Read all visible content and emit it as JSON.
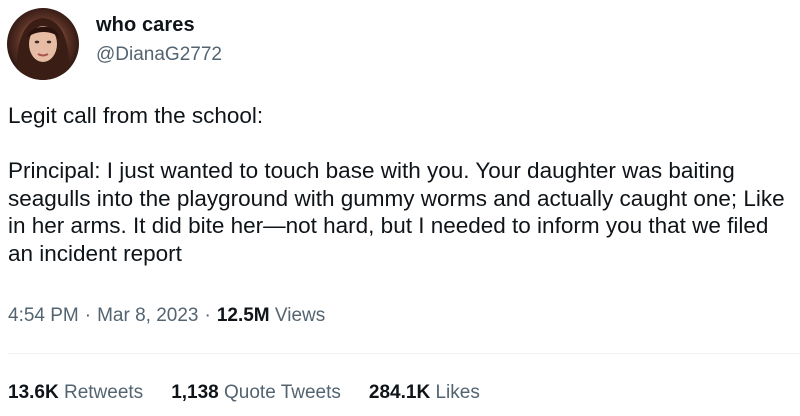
{
  "user": {
    "display_name": "who cares",
    "handle": "@DianaG2772"
  },
  "tweet": {
    "text": "Legit call from the school:\n\nPrincipal: I just wanted to touch base with you.  Your daughter was baiting seagulls into the playground with gummy worms and actually caught one; Like in her arms. It did bite her—not hard, but I needed to inform you that we filed an incident report",
    "time": "4:54 PM",
    "date": "Mar 8, 2023",
    "views_count": "12.5M",
    "views_label": "Views",
    "separator": "·"
  },
  "stats": {
    "retweets_count": "13.6K",
    "retweets_label": "Retweets",
    "quotes_count": "1,138",
    "quotes_label": "Quote Tweets",
    "likes_count": "284.1K",
    "likes_label": "Likes"
  }
}
